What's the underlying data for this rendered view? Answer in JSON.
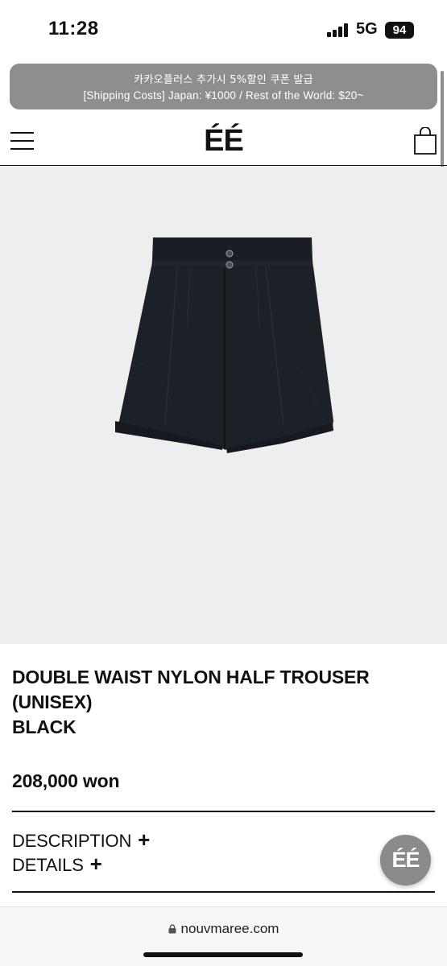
{
  "status": {
    "time": "11:28",
    "network": "5G",
    "battery": "94"
  },
  "banner": {
    "line1": "카카오플러스 추가시 5%할인 쿠폰 발급",
    "line2": "[Shipping Costs] Japan: ¥1000 / Rest of the World: $20~"
  },
  "header": {
    "logo": "ÉÉ",
    "menu_icon": "hamburger-menu-icon",
    "bag_icon": "shopping-bag-icon"
  },
  "product": {
    "title_line1": "DOUBLE WAIST NYLON HALF TROUSER",
    "title_line2": "(UNISEX)",
    "color": "BLACK",
    "price": "208,000 won"
  },
  "accordions": {
    "description": "DESCRIPTION",
    "details": "DETAILS",
    "expand_icon": "+"
  },
  "fab": {
    "label": "ÉÉ"
  },
  "browser": {
    "url": "nouvmaree.com"
  },
  "colors": {
    "banner_bg": "#8e8e8e",
    "image_bg": "#eeeeee",
    "fab_bg": "#8a8a8a",
    "text": "#111111"
  }
}
